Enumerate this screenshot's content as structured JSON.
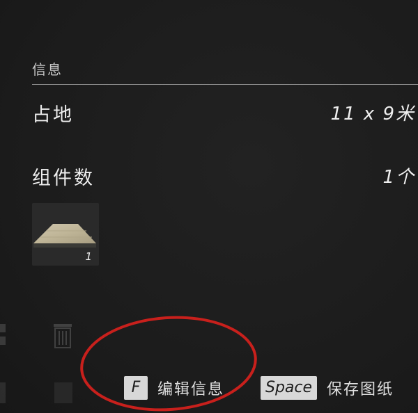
{
  "info_panel": {
    "section_title": "信息",
    "rows": [
      {
        "label": "占地",
        "value": "11 x 9米"
      },
      {
        "label": "组件数",
        "value": "1个"
      }
    ],
    "components": [
      {
        "name": "wood-floor-tile",
        "quantity": "1"
      }
    ]
  },
  "hints": [
    {
      "key": "F",
      "label": "编辑信息"
    },
    {
      "key": "Space",
      "label": "保存图纸"
    }
  ],
  "left_icons": [
    "blueprint-icon",
    "trash-icon",
    "box-icon",
    "list-icon"
  ],
  "colors": {
    "background": "#1d1d1d",
    "key_background": "#d8d8d8",
    "annotation": "#c8201c"
  }
}
